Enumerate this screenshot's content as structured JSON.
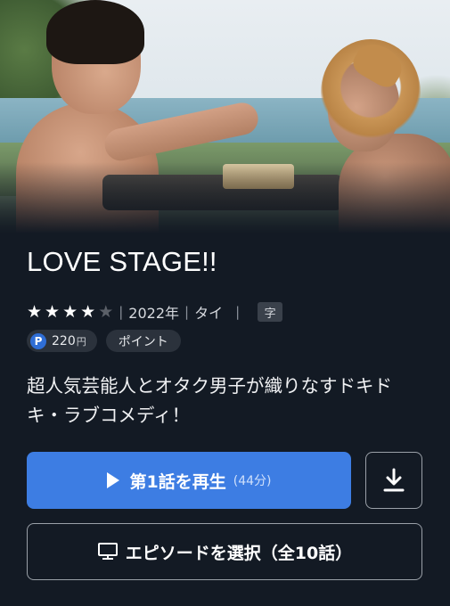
{
  "title": "LOVE STAGE!!",
  "rating": {
    "stars": 4,
    "max": 5
  },
  "meta": {
    "separator": "|",
    "year": "2022年",
    "country": "タイ",
    "subtitle_badge": "字"
  },
  "price": {
    "icon_letter": "P",
    "amount": "220",
    "unit": "円",
    "points_label": "ポイント"
  },
  "description": "超人気芸能人とオタク男子が織りなすドキドキ・ラブコメディ！",
  "play_button": {
    "label": "第1話を再生",
    "duration": "(44分)"
  },
  "episode_button": {
    "label": "エピソードを選択（全10話）"
  },
  "colors": {
    "background": "#131a24",
    "accent": "#3d7de3",
    "point_badge": "#2f6ed6"
  },
  "icons": [
    "play-icon",
    "download-icon",
    "tv-icon",
    "star-icon"
  ]
}
